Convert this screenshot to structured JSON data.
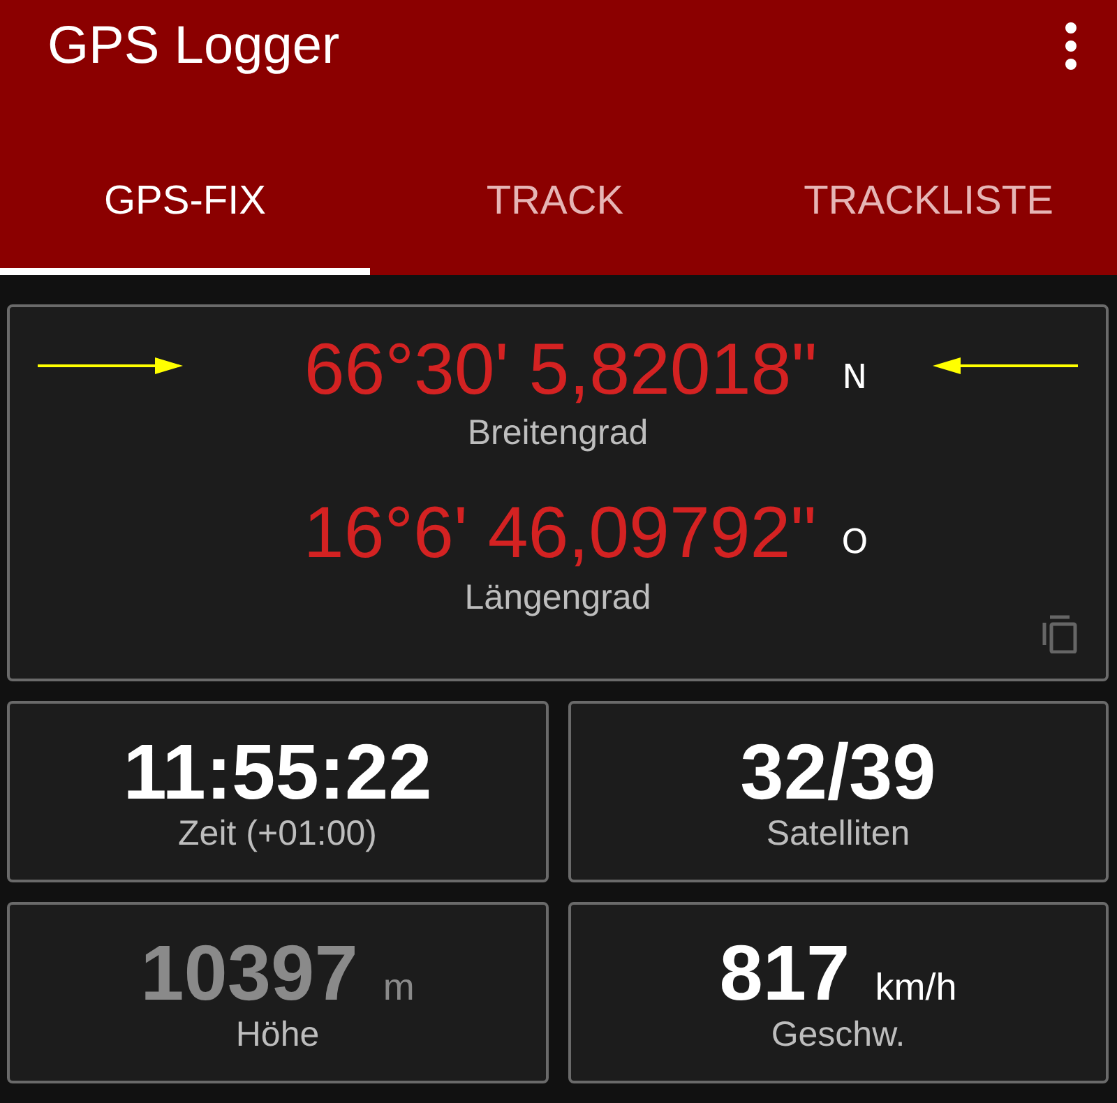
{
  "app_bar": {
    "title": "GPS Logger"
  },
  "tabs": [
    {
      "label": "GPS-FIX",
      "selected": true
    },
    {
      "label": "TRACK",
      "selected": false
    },
    {
      "label": "TRACKLISTE",
      "selected": false
    }
  ],
  "coordinates": [
    {
      "value": "66°30' 5,82018\"",
      "hemisphere": "N",
      "label": "Breitengrad",
      "marked": true
    },
    {
      "value": "16°6' 46,09792\"",
      "hemisphere": "O",
      "label": "Längengrad",
      "marked": false
    }
  ],
  "tiles": [
    {
      "value": "11:55:22",
      "label": "Zeit (+01:00)",
      "dimmed": false
    },
    {
      "value": "32/39",
      "label": "Satelliten",
      "dimmed": false
    },
    {
      "value": "10397",
      "unit": "m",
      "label": "Höhe",
      "dimmed": true
    },
    {
      "value": "817",
      "unit": "km/h",
      "label": "Geschw.",
      "dimmed": false
    }
  ]
}
